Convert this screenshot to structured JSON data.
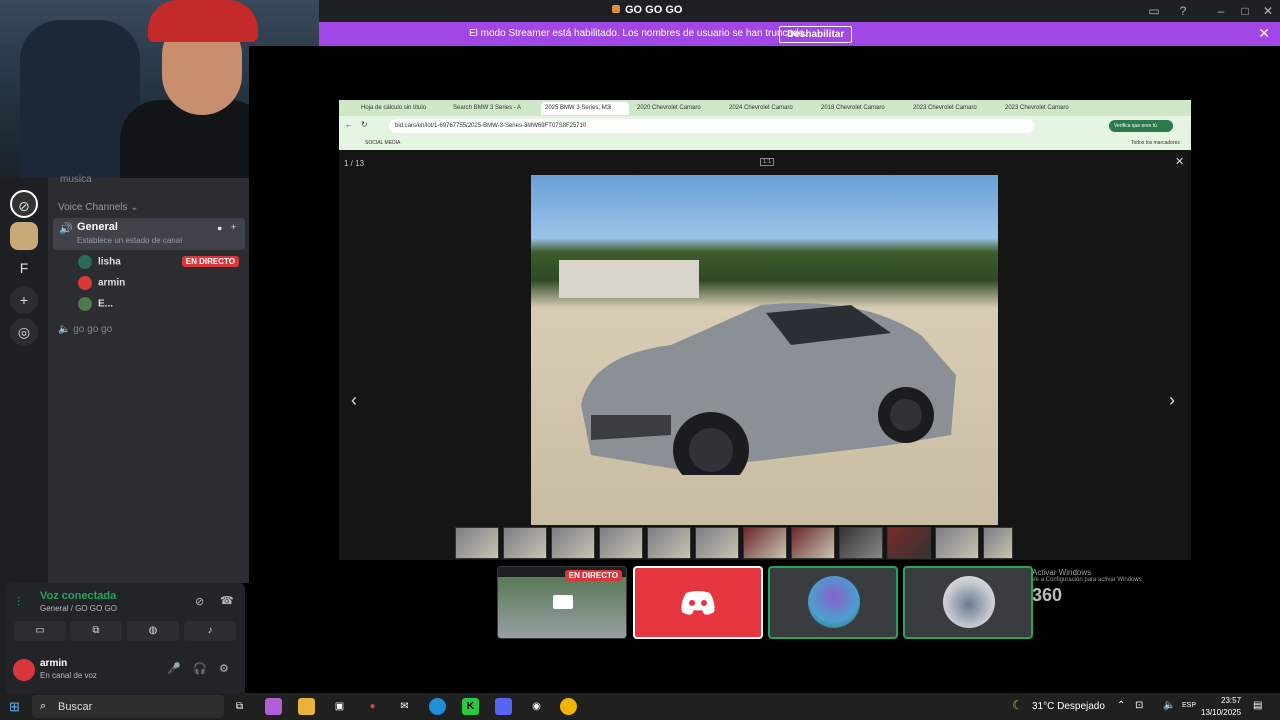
{
  "app": {
    "title": "GO GO GO"
  },
  "streamer_bar": {
    "message": "El modo Streamer está habilitado. Los nombres de usuario se han truncado.",
    "button": "Deshabilitar"
  },
  "server_rail": {
    "letter_server": "F"
  },
  "channels": {
    "partial_above": "musica",
    "category": "Voice Channels",
    "general": {
      "name": "General",
      "status_placeholder": "Establece un estado de canal"
    },
    "members": [
      {
        "name": "lisha",
        "badge": "EN DIRECTO"
      },
      {
        "name": "armin",
        "badge": ""
      },
      {
        "name": "E...",
        "badge": ""
      }
    ],
    "other_channel": "go go go"
  },
  "voice_panel": {
    "status": "Voz conectada",
    "location": "General / GO GO GO"
  },
  "user_panel": {
    "name": "armin",
    "status": "En canal de voz"
  },
  "browser": {
    "tabs": [
      "Hoja de cálculo sin título",
      "Search BMW 3 Series - A",
      "2025 BMW 3 Series, M3i",
      "2020 Chevrolet Camaro",
      "2024 Chevrolet Camaro",
      "2018 Chevrolet Camaro",
      "2023 Chevrolet Camaro",
      "2023 Chevrolet Camaro"
    ],
    "url": "bid.cars/en/lot/1-69767755/2025-BMW-3-Series-3MW69FT07S8F25710",
    "verify_label": "Verifica que eres tú",
    "bookmark": "SOCIAL MEDIA",
    "bookmark_right": "Todos los marcadores",
    "viewer_counter": "1 / 13",
    "ratio_label": "1:1"
  },
  "watermark": {
    "line1": "Activar Windows",
    "line2": "Ve a Configuración para activar Windows",
    "badge": "360"
  },
  "tiles": {
    "live_badge": "EN DIRECTO"
  },
  "taskbar": {
    "search": "Buscar",
    "weather": "31°C  Despejado",
    "lang": "ESP",
    "time": "23:57",
    "date": "13/10/2025"
  },
  "colors": {
    "streamer_bar": "#a147e6",
    "live_red": "#da373c",
    "voice_green": "#23a55a",
    "discord_blurple": "#5865f2"
  }
}
